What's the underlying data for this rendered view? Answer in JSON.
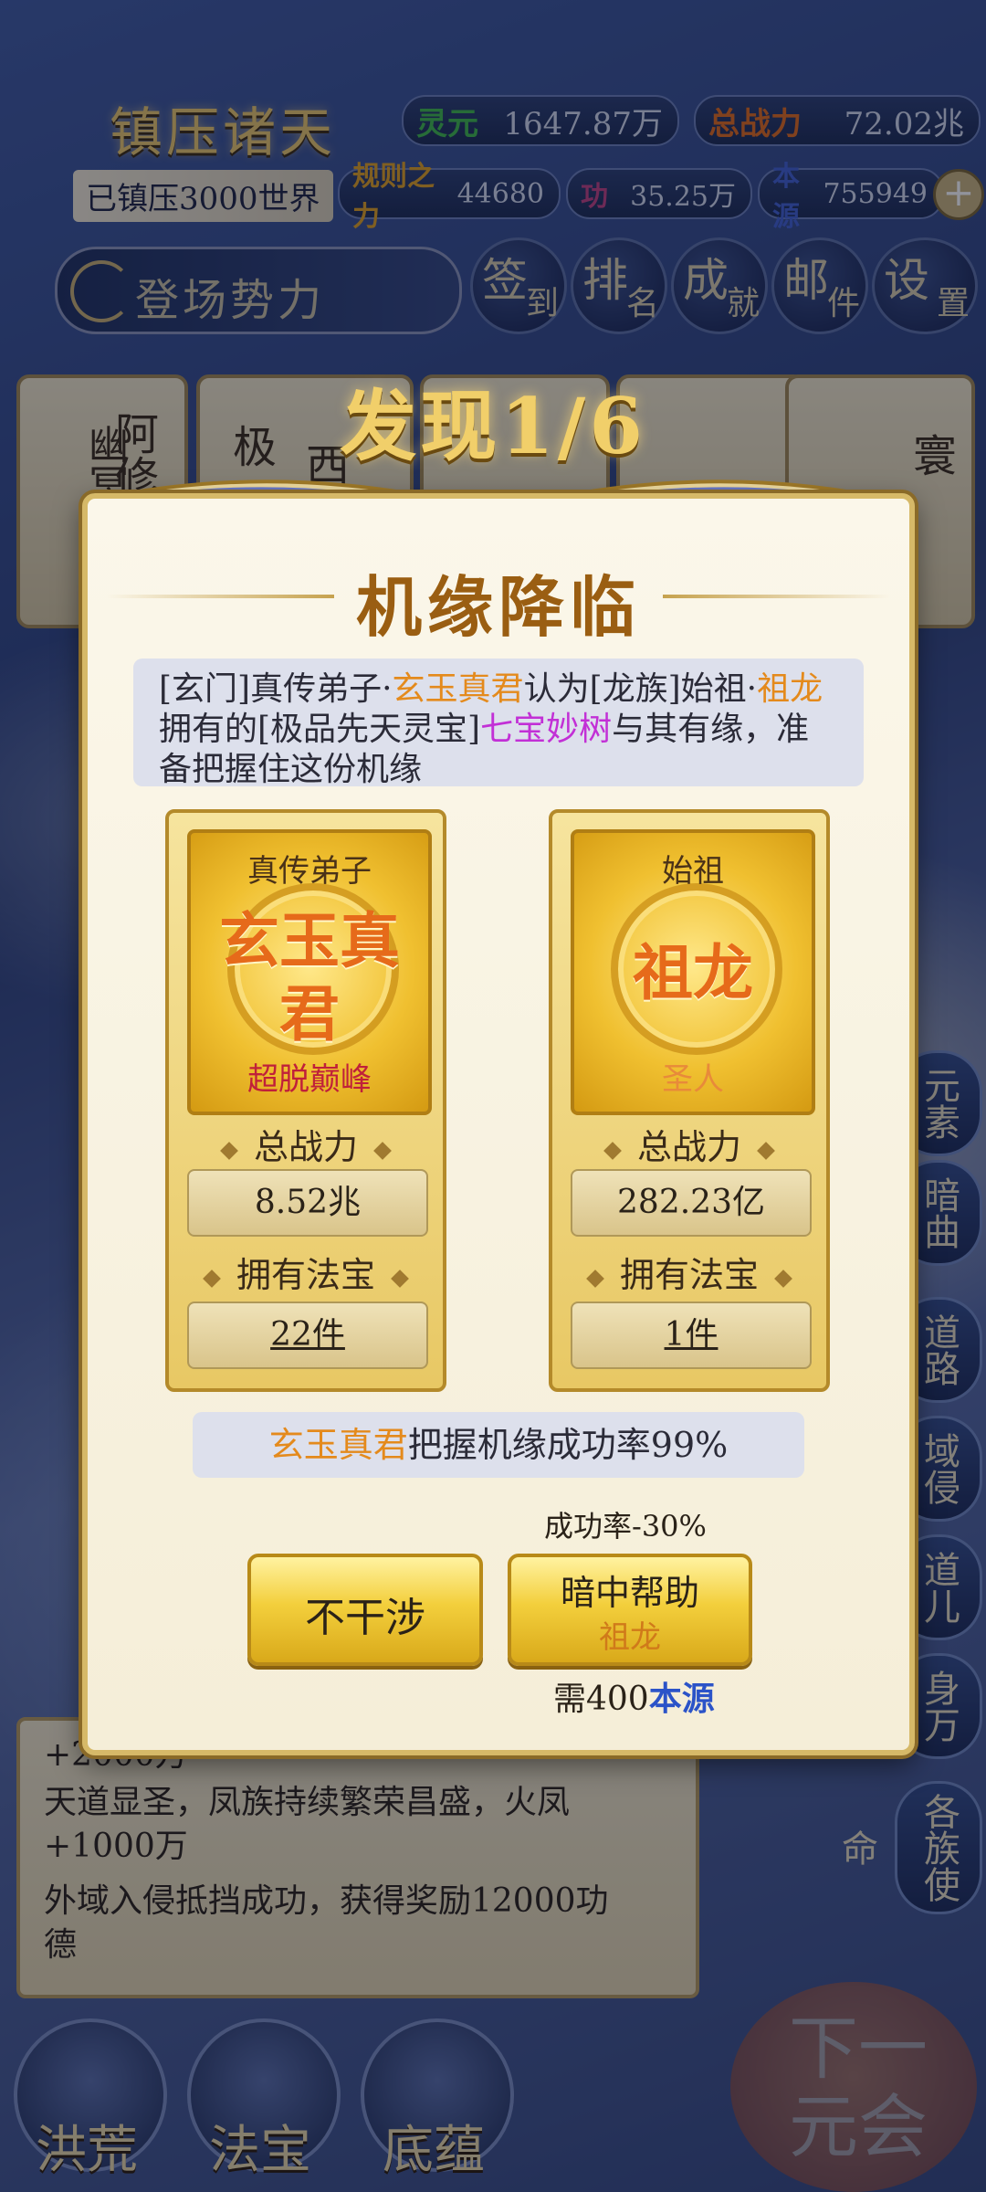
{
  "header": {
    "game_title": "镇压诸天",
    "suppressed": "已镇压3000世界",
    "stats": [
      {
        "label": "灵元",
        "value": "1647.87万",
        "color": "#3fb84a"
      },
      {
        "label": "总战力",
        "value": "72.02兆",
        "color": "#e06a1a"
      },
      {
        "label": "规则之力",
        "value": "44680",
        "color": "#e0a020"
      },
      {
        "label": "功",
        "value": "35.25万",
        "color": "#c04080"
      },
      {
        "label": "本源",
        "value": "755949",
        "color": "#4060d0"
      }
    ],
    "entry_bar": "登场势力",
    "round_buttons": [
      {
        "a": "签",
        "b": "到"
      },
      {
        "a": "排",
        "b": "名"
      },
      {
        "a": "成",
        "b": "就"
      },
      {
        "a": "邮",
        "b": "件"
      },
      {
        "a": "设",
        "b": "置"
      }
    ]
  },
  "faction_cards": [
    "幽冥血海",
    "阿修",
    "极",
    "西",
    "寰"
  ],
  "side_buttons": [
    "元素",
    "暗曲",
    "道路",
    "域侵",
    "道儿",
    "身万",
    "各族使命"
  ],
  "log": {
    "lines": [
      "+2000万",
      "天道显圣，凤族持续繁荣昌盛，火凤",
      "+1000万",
      "外域入侵抵挡成功，获得奖励12000功",
      "德"
    ]
  },
  "bottom_nav": [
    "洪荒",
    "法宝",
    "底蕴"
  ],
  "next_button": "下一元会",
  "modal": {
    "discover": "发现1/6",
    "heading": "机缘降临",
    "desc": {
      "p1": "[玄门]真传弟子·",
      "name1": "玄玉真君",
      "p2": "认为[龙族]始祖·",
      "name2": "祖龙",
      "p3": "拥有的[极品先天灵宝]",
      "item": "七宝妙树",
      "p4": "与其有缘，准备把握住这份机缘"
    },
    "left_card": {
      "rank": "真传弟子",
      "name": "玄玉真君",
      "tier": "超脱巅峰",
      "tier_color": "#c0203a",
      "power_label": "总战力",
      "power": "8.52兆",
      "treasure_label": "拥有法宝",
      "treasure": "22件"
    },
    "right_card": {
      "rank": "始祖",
      "name": "祖龙",
      "tier": "圣人",
      "tier_color": "#e88a3a",
      "power_label": "总战力",
      "power": "282.23亿",
      "treasure_label": "拥有法宝",
      "treasure": "1件"
    },
    "rate": {
      "name": "玄玉真君",
      "text": "把握机缘成功率99%"
    },
    "penalty": "成功率-30%",
    "btn_no": "不干涉",
    "btn_help_line1": "暗中帮助",
    "btn_help_line2": "祖龙",
    "cost_prefix": "需400",
    "cost_unit": "本源"
  }
}
